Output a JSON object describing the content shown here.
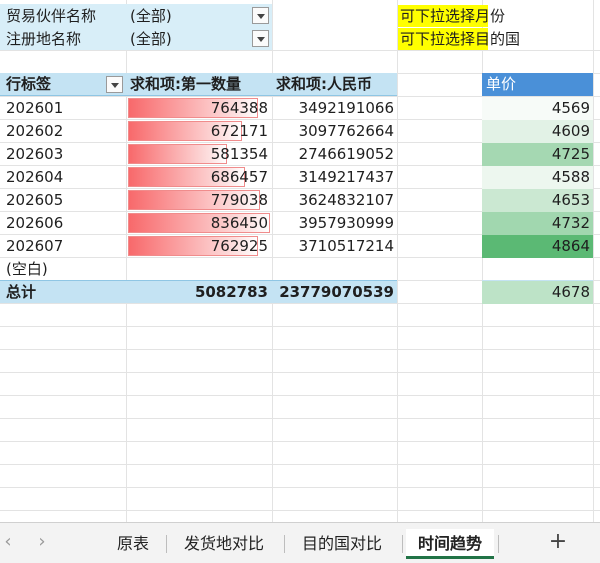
{
  "filters": [
    {
      "label": "贸易伙伴名称",
      "value": "(全部)",
      "hint": "可下拉选择月份",
      "hint_highlight": "可下拉选择"
    },
    {
      "label": "注册地名称",
      "value": "(全部)",
      "hint": "可下拉选择目的国",
      "hint_highlight": "可下拉选择"
    }
  ],
  "pivot": {
    "headers": [
      "行标签",
      "求和项:第一数量",
      "求和项:人民币"
    ],
    "rows": [
      {
        "label": "202601",
        "qty": "764388",
        "rmb": "3492191066",
        "qty_value": 764388
      },
      {
        "label": "202602",
        "qty": "672171",
        "rmb": "3097762664",
        "qty_value": 672171
      },
      {
        "label": "202603",
        "qty": "581354",
        "rmb": "2746619052",
        "qty_value": 581354
      },
      {
        "label": "202604",
        "qty": "686457",
        "rmb": "3149217437",
        "qty_value": 686457
      },
      {
        "label": "202605",
        "qty": "779038",
        "rmb": "3624832107",
        "qty_value": 779038
      },
      {
        "label": "202606",
        "qty": "836450",
        "rmb": "3957930999",
        "qty_value": 836450
      },
      {
        "label": "202607",
        "qty": "762925",
        "rmb": "3710517214",
        "qty_value": 762925
      }
    ],
    "blank_label": "(空白)",
    "total": {
      "label": "总计",
      "qty": "5082783",
      "rmb": "23779070539"
    }
  },
  "price": {
    "header": "单价",
    "values": [
      4569,
      4609,
      4725,
      4588,
      4653,
      4732,
      4864
    ],
    "total": 4678,
    "colors": {
      "header": "#4a90d8",
      "low": "#f7fbf8",
      "high": "#5bb974"
    }
  },
  "tabs": {
    "prev_icon": "‹",
    "next_icon": "›",
    "items": [
      {
        "label": "原表",
        "active": false
      },
      {
        "label": "发货地对比",
        "active": false
      },
      {
        "label": "目的国对比",
        "active": false
      },
      {
        "label": "时间趋势",
        "active": true
      }
    ],
    "add_label": "+"
  }
}
